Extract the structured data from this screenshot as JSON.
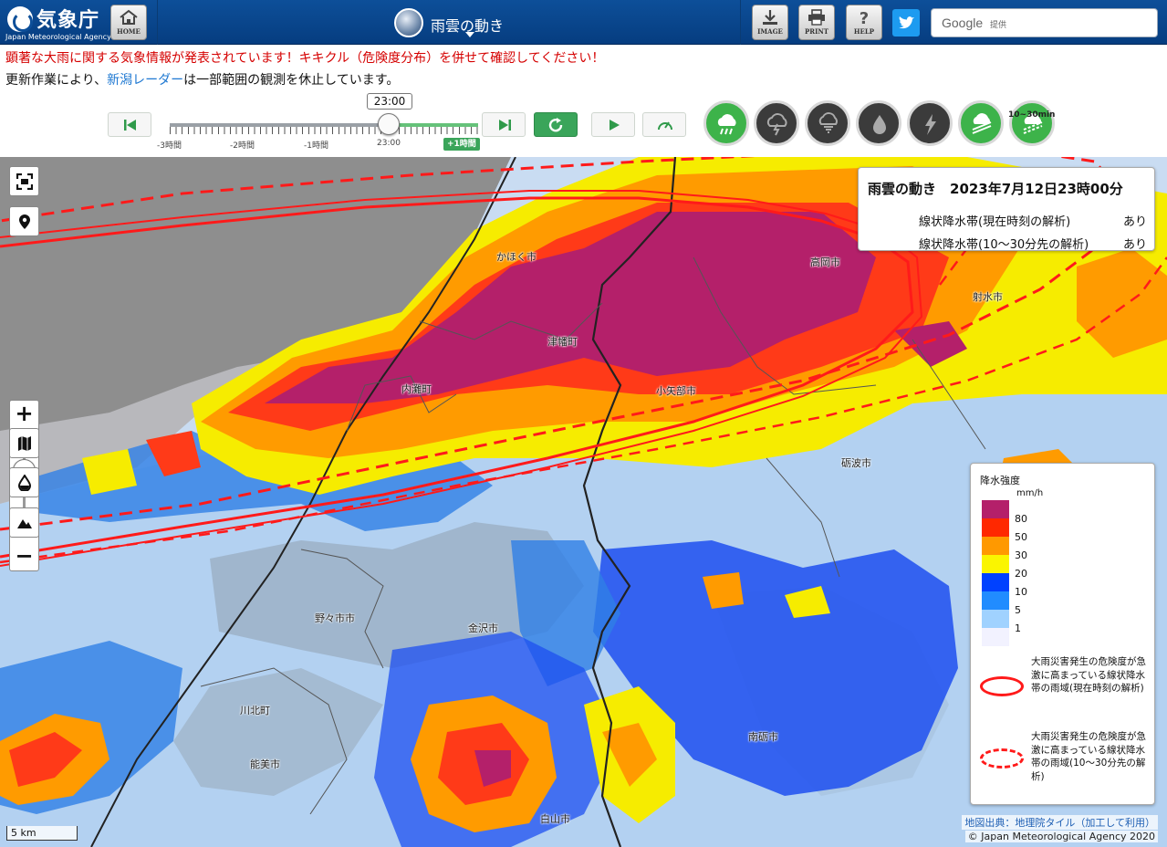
{
  "header": {
    "logo_jp": "気象庁",
    "logo_en": "Japan Meteorological Agency",
    "home_label": "HOME",
    "title": "雨雲の動き",
    "image_label": "IMAGE",
    "print_label": "PRINT",
    "help_label": "HELP",
    "google_label": "Google",
    "google_sub": "提供"
  },
  "notices": {
    "warning": "顕著な大雨に関する気象情報が発表されています！キキクル（危険度分布）を併せて確認してください！",
    "update_prefix": "更新作業により、",
    "update_link": "新潟レーダー",
    "update_suffix": "は一部範囲の観測を休止しています。"
  },
  "timeline": {
    "current_time": "23:00",
    "ticks": [
      "-3時間",
      "-2時間",
      "-1時間",
      "23:00"
    ],
    "plus_label": "+1時間",
    "position_fraction": 0.71
  },
  "layers": {
    "extra_label": "10~30min",
    "items": [
      {
        "name": "rain-cloud",
        "active": true
      },
      {
        "name": "thunder-cloud",
        "active": false
      },
      {
        "name": "tornado-cloud",
        "active": false
      },
      {
        "name": "rain-drop",
        "active": false
      },
      {
        "name": "lightning",
        "active": false
      },
      {
        "name": "linear-band",
        "active": true
      },
      {
        "name": "linear-band-forecast",
        "active": true
      }
    ]
  },
  "info": {
    "title": "雨雲の動き　2023年7月12日23時00分",
    "rows": [
      {
        "label": "線状降水帯(現在時刻の解析)",
        "value": "あり"
      },
      {
        "label": "線状降水帯(10～30分先の解析)",
        "value": "あり"
      }
    ]
  },
  "legend": {
    "title": "降水強度",
    "unit": "mm/h",
    "levels": [
      {
        "value": "80",
        "color": "#b4206a"
      },
      {
        "value": "50",
        "color": "#ff2800"
      },
      {
        "value": "30",
        "color": "#ff9900"
      },
      {
        "value": "20",
        "color": "#faf500"
      },
      {
        "value": "10",
        "color": "#0041ff"
      },
      {
        "value": "5",
        "color": "#218cff"
      },
      {
        "value": "1",
        "color": "#a0d2ff"
      },
      {
        "value": "",
        "color": "#f2f2ff"
      }
    ],
    "solid_desc": "大雨災害発生の危険度が急激に高まっている線状降水帯の雨域(現在時刻の解析)",
    "dashed_desc": "大雨災害発生の危険度が急激に高まっている線状降水帯の雨域(10～30分先の解析)"
  },
  "places": [
    {
      "name": "かほく市"
    },
    {
      "name": "津幡町"
    },
    {
      "name": "内灘町"
    },
    {
      "name": "小矢部市"
    },
    {
      "name": "高岡市"
    },
    {
      "name": "射水市"
    },
    {
      "name": "砺波市"
    },
    {
      "name": "野々市市"
    },
    {
      "name": "金沢市"
    },
    {
      "name": "川北町"
    },
    {
      "name": "能美市"
    },
    {
      "name": "南砺市"
    },
    {
      "name": "白山市"
    }
  ],
  "map": {
    "scale": "5 km",
    "credit": "地図出典：地理院タイル（加工して利用）",
    "copyright": "© Japan Meteorological Agency 2020"
  },
  "colors": {
    "header_bg": "#0d4f99",
    "warning_red": "#d50000",
    "link_blue": "#1e78d2",
    "active_green": "#3aa55a",
    "band_red": "#ff1a1a"
  }
}
